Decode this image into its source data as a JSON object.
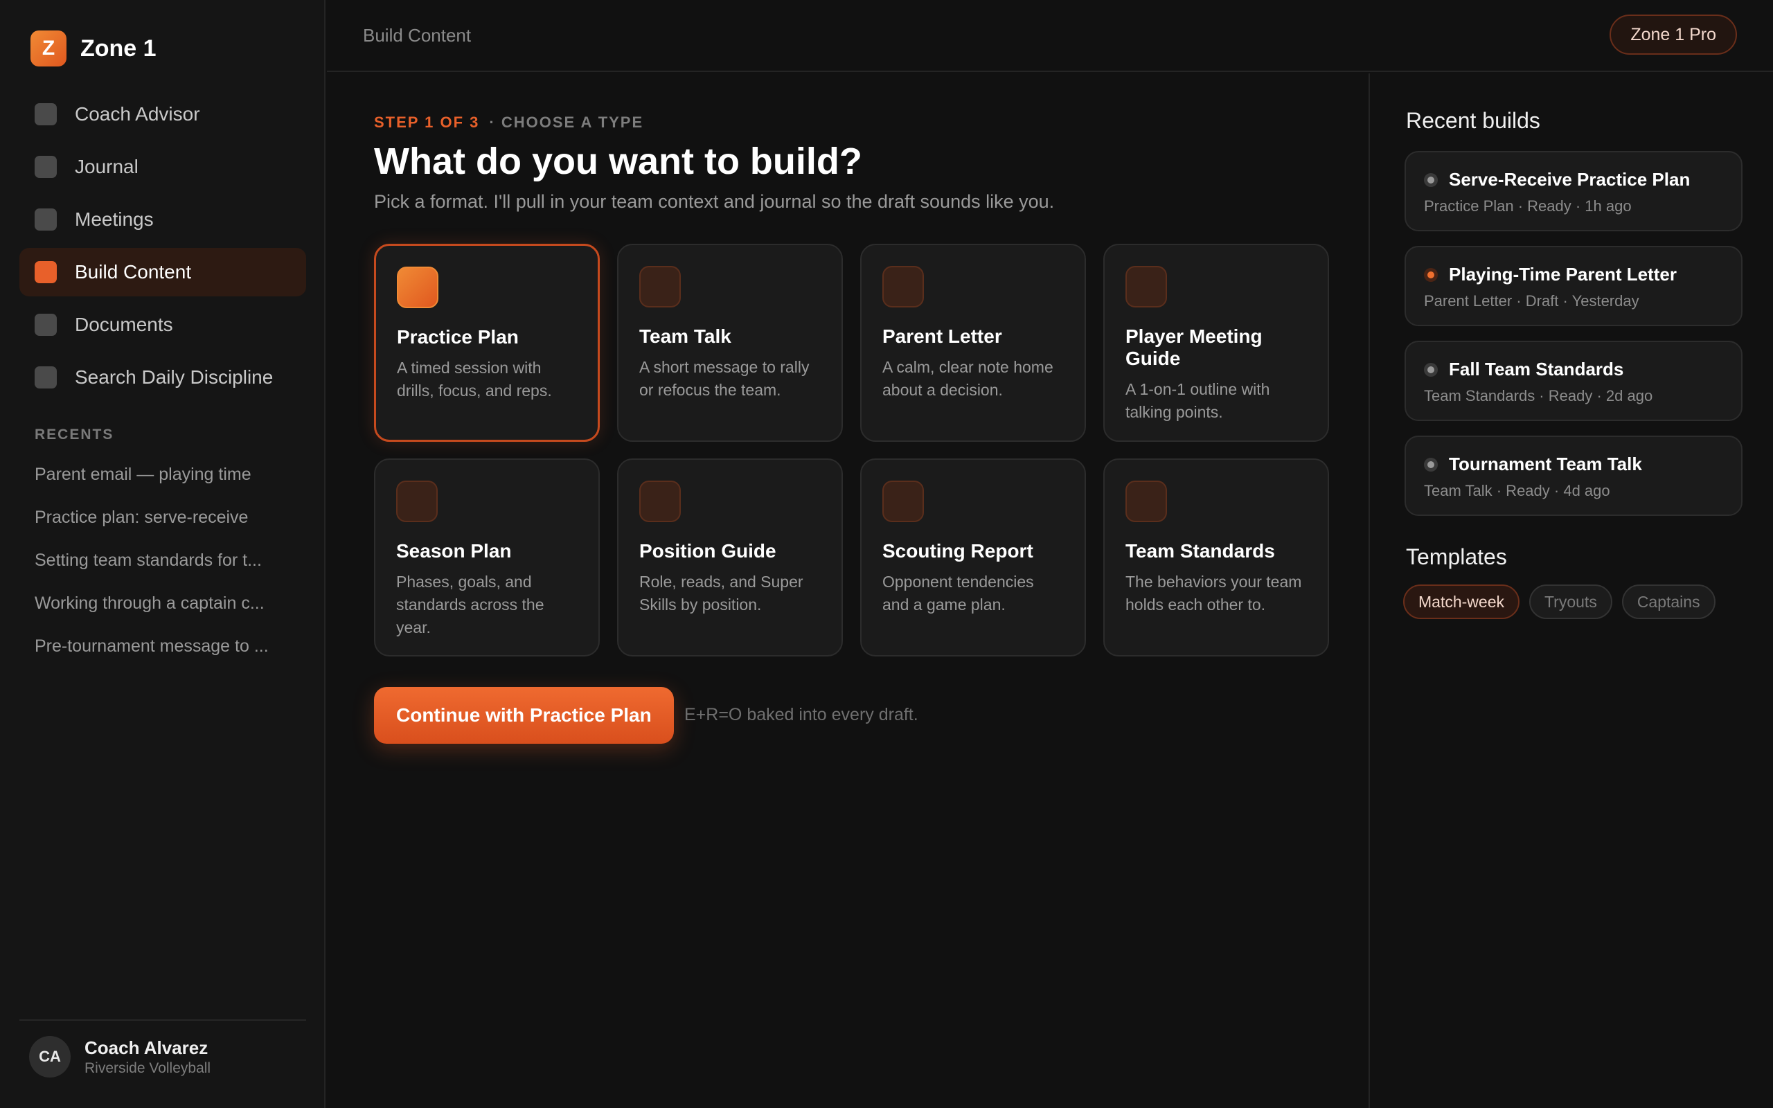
{
  "brand": {
    "logo_letter": "Z",
    "name": "Zone 1"
  },
  "nav": [
    {
      "label": "Coach Advisor",
      "active": false
    },
    {
      "label": "Journal",
      "active": false
    },
    {
      "label": "Meetings",
      "active": false
    },
    {
      "label": "Build Content",
      "active": true
    },
    {
      "label": "Documents",
      "active": false
    },
    {
      "label": "Search Daily Discipline",
      "active": false
    }
  ],
  "recents": {
    "title": "RECENTS",
    "items": [
      "Parent email — playing time",
      "Practice plan: serve-receive",
      "Setting team standards for t...",
      "Working through a captain c...",
      "Pre-tournament message to ..."
    ]
  },
  "user": {
    "initials": "CA",
    "name": "Coach Alvarez",
    "team": "Riverside Volleyball"
  },
  "topbar": {
    "title": "Build Content",
    "badge": "Zone 1 Pro"
  },
  "main": {
    "step": "STEP 1 OF 3",
    "step_sub": "· CHOOSE A TYPE",
    "heading": "What do you want to build?",
    "subheading": "Pick a format. I'll pull in your team context and journal so the draft sounds like you.",
    "cards": [
      {
        "title": "Practice Plan",
        "desc": "A timed session with drills, focus, and reps.",
        "selected": true
      },
      {
        "title": "Team Talk",
        "desc": "A short message to rally or refocus the team.",
        "selected": false
      },
      {
        "title": "Parent Letter",
        "desc": "A calm, clear note home about a decision.",
        "selected": false
      },
      {
        "title": "Player Meeting Guide",
        "desc": "A 1-on-1 outline with talking points.",
        "selected": false
      },
      {
        "title": "Season Plan",
        "desc": "Phases, goals, and standards across the year.",
        "selected": false
      },
      {
        "title": "Position Guide",
        "desc": "Role, reads, and Super Skills by position.",
        "selected": false
      },
      {
        "title": "Scouting Report",
        "desc": "Opponent tendencies and a game plan.",
        "selected": false
      },
      {
        "title": "Team Standards",
        "desc": "The behaviors your team holds each other to.",
        "selected": false
      }
    ],
    "continue_label": "Continue with Practice Plan",
    "hint": "E+R=O baked into every draft."
  },
  "right": {
    "recent_title": "Recent builds",
    "builds": [
      {
        "title": "Serve-Receive Practice Plan",
        "meta": "Practice Plan · Ready · 1h ago",
        "status": "ready"
      },
      {
        "title": "Playing-Time Parent Letter",
        "meta": "Parent Letter · Draft · Yesterday",
        "status": "draft"
      },
      {
        "title": "Fall Team Standards",
        "meta": "Team Standards · Ready · 2d ago",
        "status": "ready"
      },
      {
        "title": "Tournament Team Talk",
        "meta": "Team Talk · Ready · 4d ago",
        "status": "ready"
      }
    ],
    "templates_title": "Templates",
    "templates": [
      {
        "label": "Match-week",
        "active": true
      },
      {
        "label": "Tryouts",
        "active": false
      },
      {
        "label": "Captains",
        "active": false
      }
    ]
  },
  "colors": {
    "accent": "#e8602a",
    "background": "#111111",
    "card": "#1b1b1b"
  }
}
